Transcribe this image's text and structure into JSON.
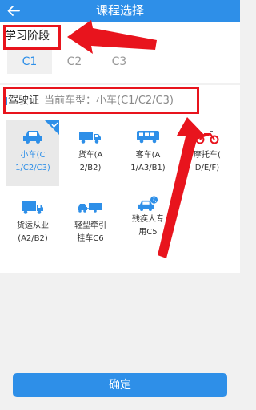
{
  "header": {
    "title": "课程选择"
  },
  "stage": {
    "label": "学习阶段",
    "tabs": [
      {
        "label": "C1",
        "selected": true
      },
      {
        "label": "C2",
        "selected": false
      },
      {
        "label": "C3",
        "selected": false
      }
    ]
  },
  "license": {
    "label": "驾驶证",
    "current_type": "当前车型：小车(C1/C2/C3)",
    "vehicles": [
      {
        "label": "小车(C1/C2/C3)",
        "line1": "小车(C",
        "line2": "1/C2/C3)",
        "icon": "car-icon",
        "selected": true
      },
      {
        "label": "货车(A2/B2)",
        "line1": "货车(A",
        "line2": "2/B2)",
        "icon": "truck-icon",
        "selected": false
      },
      {
        "label": "客车(A1/A3/B1)",
        "line1": "客车(A",
        "line2": "1/A3/B1)",
        "icon": "bus-icon",
        "selected": false
      },
      {
        "label": "摩托车(D/E/F)",
        "line1": "摩托车(",
        "line2": "D/E/F)",
        "icon": "motorcycle-icon",
        "selected": false
      },
      {
        "label": "货运从业(A2/B2)",
        "line1": "货运从业",
        "line2": "(A2/B2)",
        "icon": "cargo-truck-icon",
        "selected": false
      },
      {
        "label": "轻型牵引挂车C6",
        "line1": "轻型牵引",
        "line2": "挂车C6",
        "icon": "trailer-icon",
        "selected": false
      },
      {
        "label": "残疾人专用C5",
        "line1": "残疾人专",
        "line2": "用C5",
        "icon": "accessible-car-icon",
        "selected": false
      }
    ]
  },
  "confirm": {
    "label": "确定"
  },
  "colors": {
    "primary": "#2e8fe8",
    "annotation": "#e8141d",
    "page_bg": "#f1f1f1"
  }
}
